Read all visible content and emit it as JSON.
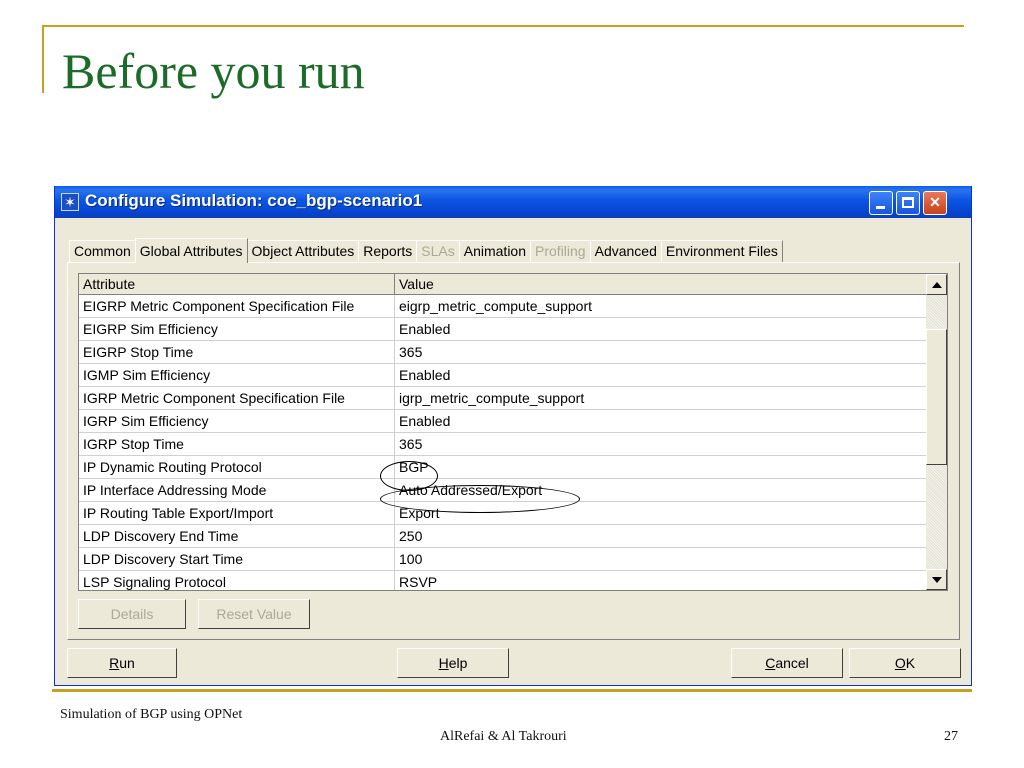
{
  "slide": {
    "title": "Before you run",
    "footer_left": "Simulation of  BGP using OPNet",
    "footer_center": "AlRefai & Al Takrouri",
    "page_number": "27"
  },
  "window": {
    "title": "Configure Simulation: coe_bgp-scenario1",
    "tabs": [
      {
        "label": "Common",
        "state": "normal"
      },
      {
        "label": "Global Attributes",
        "state": "active"
      },
      {
        "label": "Object Attributes",
        "state": "normal"
      },
      {
        "label": "Reports",
        "state": "normal"
      },
      {
        "label": "SLAs",
        "state": "disabled"
      },
      {
        "label": "Animation",
        "state": "normal"
      },
      {
        "label": "Profiling",
        "state": "disabled"
      },
      {
        "label": "Advanced",
        "state": "normal"
      },
      {
        "label": "Environment Files",
        "state": "normal"
      }
    ],
    "grid": {
      "columns": [
        "Attribute",
        "Value"
      ],
      "rows": [
        {
          "attribute": "EIGRP Metric Component Specification File",
          "value": "eigrp_metric_compute_support"
        },
        {
          "attribute": "EIGRP Sim Efficiency",
          "value": "Enabled"
        },
        {
          "attribute": "EIGRP Stop Time",
          "value": "365"
        },
        {
          "attribute": "IGMP Sim Efficiency",
          "value": "Enabled"
        },
        {
          "attribute": "IGRP Metric Component Specification File",
          "value": "igrp_metric_compute_support"
        },
        {
          "attribute": "IGRP Sim Efficiency",
          "value": "Enabled"
        },
        {
          "attribute": "IGRP Stop Time",
          "value": "365"
        },
        {
          "attribute": "IP Dynamic Routing Protocol",
          "value": "BGP"
        },
        {
          "attribute": "IP Interface Addressing Mode",
          "value": "Auto Addressed/Export"
        },
        {
          "attribute": "IP Routing Table Export/Import",
          "value": "Export"
        },
        {
          "attribute": "LDP Discovery End Time",
          "value": "250"
        },
        {
          "attribute": "LDP Discovery Start Time",
          "value": "100"
        },
        {
          "attribute": "LSP Signaling Protocol",
          "value": "RSVP"
        }
      ]
    },
    "panel_buttons": {
      "details": "Details",
      "reset_value": "Reset Value"
    },
    "bottom_buttons": {
      "run": {
        "mnemonic": "R",
        "rest": "un"
      },
      "help": {
        "mnemonic": "H",
        "rest": "elp"
      },
      "cancel": {
        "mnemonic": "C",
        "rest": "ancel"
      },
      "ok": {
        "mnemonic": "O",
        "rest": "K"
      }
    }
  },
  "colors": {
    "title_green": "#1c6b28",
    "rule_gold": "#c8a020",
    "titlebar_blue": "#0b55e2",
    "dialog_face": "#ece9d8",
    "close_red": "#c8421d"
  }
}
